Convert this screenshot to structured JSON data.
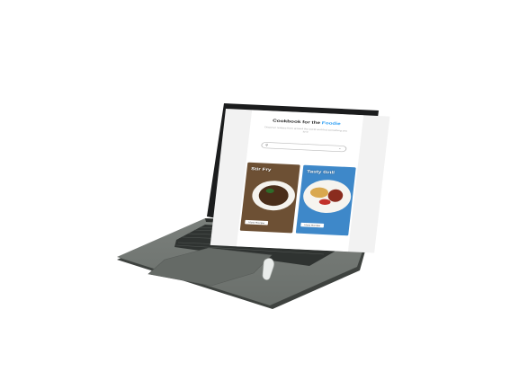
{
  "scene": {
    "background": "#ffffff",
    "laptop_color": "#6f7570"
  },
  "screen": {
    "title_prefix": "Cookbook for the ",
    "title_accent": "Foodie",
    "subtitle": "Discover recipes from around the world and find something you love",
    "search": {
      "placeholder": "",
      "icon": "search-icon"
    },
    "cards": [
      {
        "title": "Stir Fry",
        "button": "View Recipe",
        "accent": "#6d5034"
      },
      {
        "title": "Tasty Grill",
        "button": "View Recipe",
        "accent": "#3e88c9"
      }
    ]
  }
}
